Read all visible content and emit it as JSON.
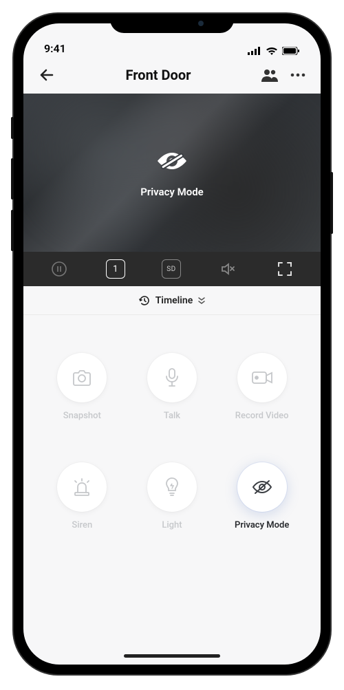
{
  "status": {
    "time": "9:41"
  },
  "header": {
    "title": "Front Door"
  },
  "video": {
    "overlay_label": "Privacy Mode"
  },
  "toolbar": {
    "layout_value": "1",
    "quality_value": "SD"
  },
  "timeline": {
    "label": "Timeline"
  },
  "actions": {
    "snapshot": "Snapshot",
    "talk": "Talk",
    "record": "Record Video",
    "siren": "Siren",
    "light": "Light",
    "privacy": "Privacy Mode"
  }
}
